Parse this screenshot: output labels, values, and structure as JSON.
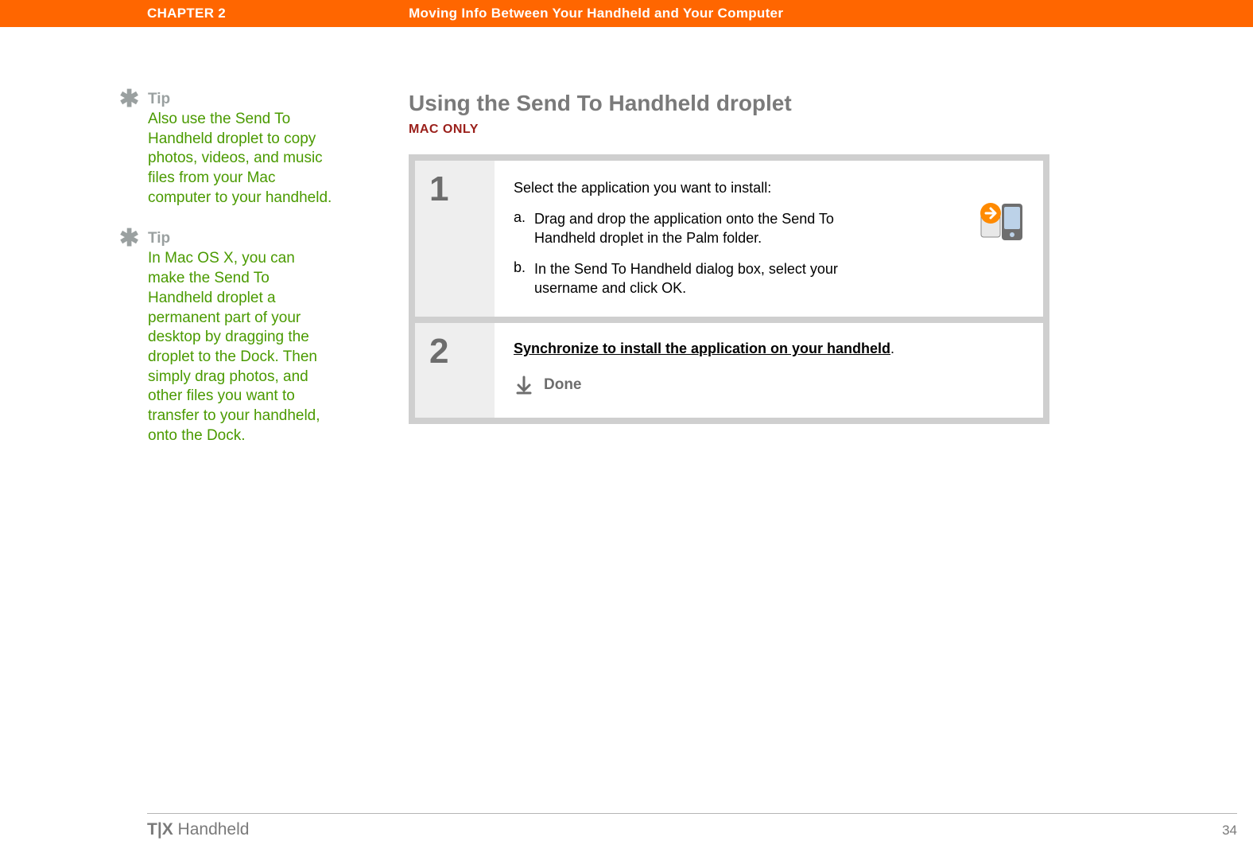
{
  "header": {
    "chapter": "CHAPTER 2",
    "title": "Moving Info Between Your Handheld and Your Computer"
  },
  "sidebar": {
    "tips": [
      {
        "label": "Tip",
        "text": "Also use the Send To Handheld droplet to copy photos, videos, and music files from your Mac computer to your handheld."
      },
      {
        "label": "Tip",
        "text": "In Mac OS X, you can make the Send To Handheld droplet a permanent part of your desktop by dragging the droplet to the Dock. Then simply drag photos, and other files you want to transfer to your handheld, onto the Dock."
      }
    ]
  },
  "main": {
    "title": "Using the Send To Handheld droplet",
    "platform_tag": "MAC ONLY",
    "steps": [
      {
        "num": "1",
        "intro": "Select the application you want to install:",
        "subs": [
          {
            "letter": "a.",
            "text": "Drag and drop the application onto the Send To Handheld droplet in the Palm folder."
          },
          {
            "letter": "b.",
            "text": "In the Send To Handheld dialog box, select your username and click OK."
          }
        ]
      },
      {
        "num": "2",
        "sync_link": "Synchronize to install the application on your handheld",
        "sync_period": ".",
        "done": "Done"
      }
    ]
  },
  "footer": {
    "brand_strong": "T|X",
    "brand_rest": " Handheld",
    "page_num": "34"
  }
}
